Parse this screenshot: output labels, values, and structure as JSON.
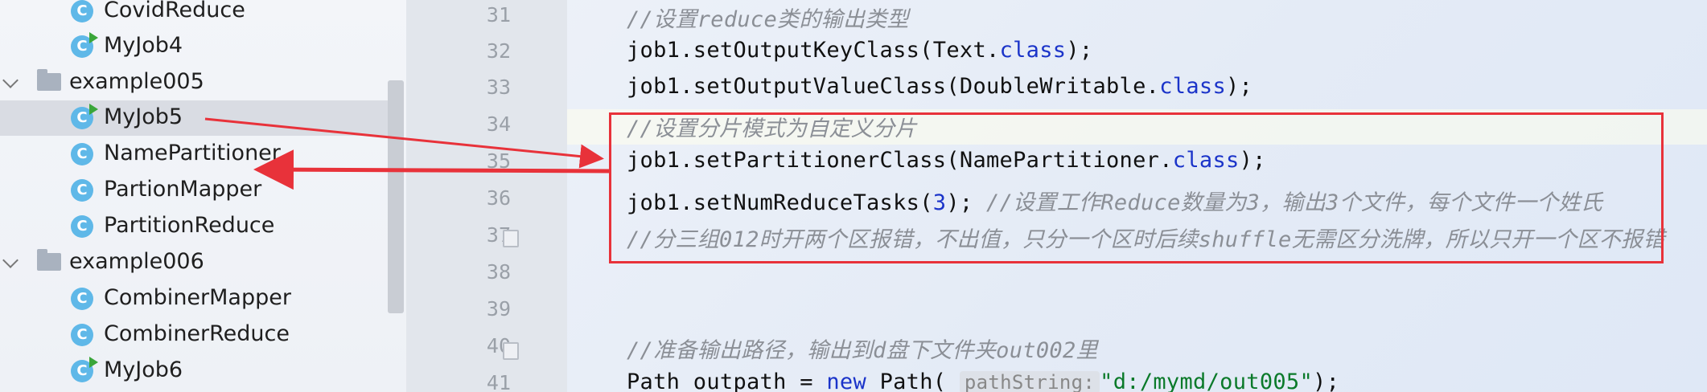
{
  "tree": {
    "items": [
      {
        "type": "class",
        "label": "CovidReduce",
        "run": false,
        "icon": "class-icon"
      },
      {
        "type": "class",
        "label": "MyJob4",
        "run": true,
        "icon": "class-run-icon"
      },
      {
        "type": "folder",
        "label": "example005",
        "icon": "package-folder-icon"
      },
      {
        "type": "class",
        "label": "MyJob5",
        "run": true,
        "selected": true,
        "icon": "class-run-icon"
      },
      {
        "type": "class",
        "label": "NamePartitioner",
        "run": false,
        "icon": "class-icon"
      },
      {
        "type": "class",
        "label": "PartionMapper",
        "run": false,
        "icon": "class-icon"
      },
      {
        "type": "class",
        "label": "PartitionReduce",
        "run": false,
        "icon": "class-icon"
      },
      {
        "type": "folder",
        "label": "example006",
        "icon": "package-folder-icon"
      },
      {
        "type": "class",
        "label": "CombinerMapper",
        "run": false,
        "icon": "class-icon"
      },
      {
        "type": "class",
        "label": "CombinerReduce",
        "run": false,
        "icon": "class-icon"
      },
      {
        "type": "class",
        "label": "MyJob6",
        "run": true,
        "icon": "class-run-icon"
      }
    ],
    "class_icon_letter": "C"
  },
  "editor": {
    "line_numbers": [
      "31",
      "32",
      "33",
      "34",
      "35",
      "36",
      "37",
      "38",
      "39",
      "40",
      "41"
    ],
    "lines": {
      "l31": {
        "comment": "//设置reduce类的输出类型"
      },
      "l32": {
        "a": "job1.setOutputKeyClass(Text.",
        "kw": "class",
        "b": ");"
      },
      "l33": {
        "a": "job1.setOutputValueClass(DoubleWritable.",
        "kw": "class",
        "b": ");"
      },
      "l34": {
        "comment": "//设置分片模式为自定义分片"
      },
      "l35": {
        "a": "job1.setPartitionerClass(NamePartitioner.",
        "kw": "class",
        "b": ");"
      },
      "l36": {
        "a": "job1.setNumReduceTasks(",
        "num": "3",
        "b": "); ",
        "comment": "//设置工作Reduce数量为3，输出3个文件，每个文件一个姓氏"
      },
      "l37": {
        "comment": "//分三组012时开两个区报错，不出值，只分一个区时后续shuffle无需区分洗牌，所以只开一个区不报错"
      },
      "l40": {
        "comment": "//准备输出路径，输出到d盘下文件夹out002里"
      },
      "l41": {
        "a": "Path outpath = ",
        "kw": "new",
        "b": " Path( ",
        "hint": "pathString:",
        "str": "\"d:/mymd/out005\"",
        "c": ");"
      }
    }
  },
  "colors": {
    "annotation_red": "#e8323a",
    "keyword_blue": "#1b34c9",
    "comment_gray": "#8b8f96",
    "string_green": "#0b7a2a",
    "class_icon_blue": "#5fb8e8"
  }
}
